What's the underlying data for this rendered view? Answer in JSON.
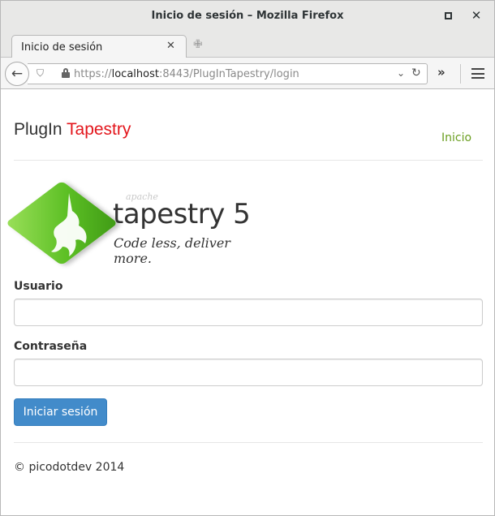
{
  "window": {
    "title": "Inicio de sesión – Mozilla Firefox"
  },
  "tab": {
    "label": "Inicio de sesión",
    "close": "×"
  },
  "nav": {
    "url_scheme": "https://",
    "url_host": "localhost",
    "url_rest": ":8443/PlugInTapestry/login",
    "back": "←",
    "overflow": "»"
  },
  "page": {
    "brand": {
      "part1": "PlugIn",
      "part2": "Tapestry"
    },
    "nav_link": "Inicio",
    "logo": {
      "apache": "apache",
      "name": "tapestry 5",
      "tagline": "Code less, deliver more."
    },
    "form": {
      "user_label": "Usuario",
      "user_value": "",
      "pass_label": "Contraseña",
      "pass_value": "",
      "submit": "Iniciar sesión"
    },
    "footer": "© picodotdev 2014"
  },
  "colors": {
    "brand_accent": "#e3161c",
    "link": "#6a9e1f",
    "primary_button": "#428bca"
  },
  "icons": [
    "back-arrow-icon",
    "shield-icon",
    "lock-icon",
    "dropdown-icon",
    "reload-icon",
    "overflow-icon",
    "hamburger-menu-icon",
    "maximize-icon",
    "close-icon",
    "new-tab-icon",
    "tapestry-logo"
  ]
}
